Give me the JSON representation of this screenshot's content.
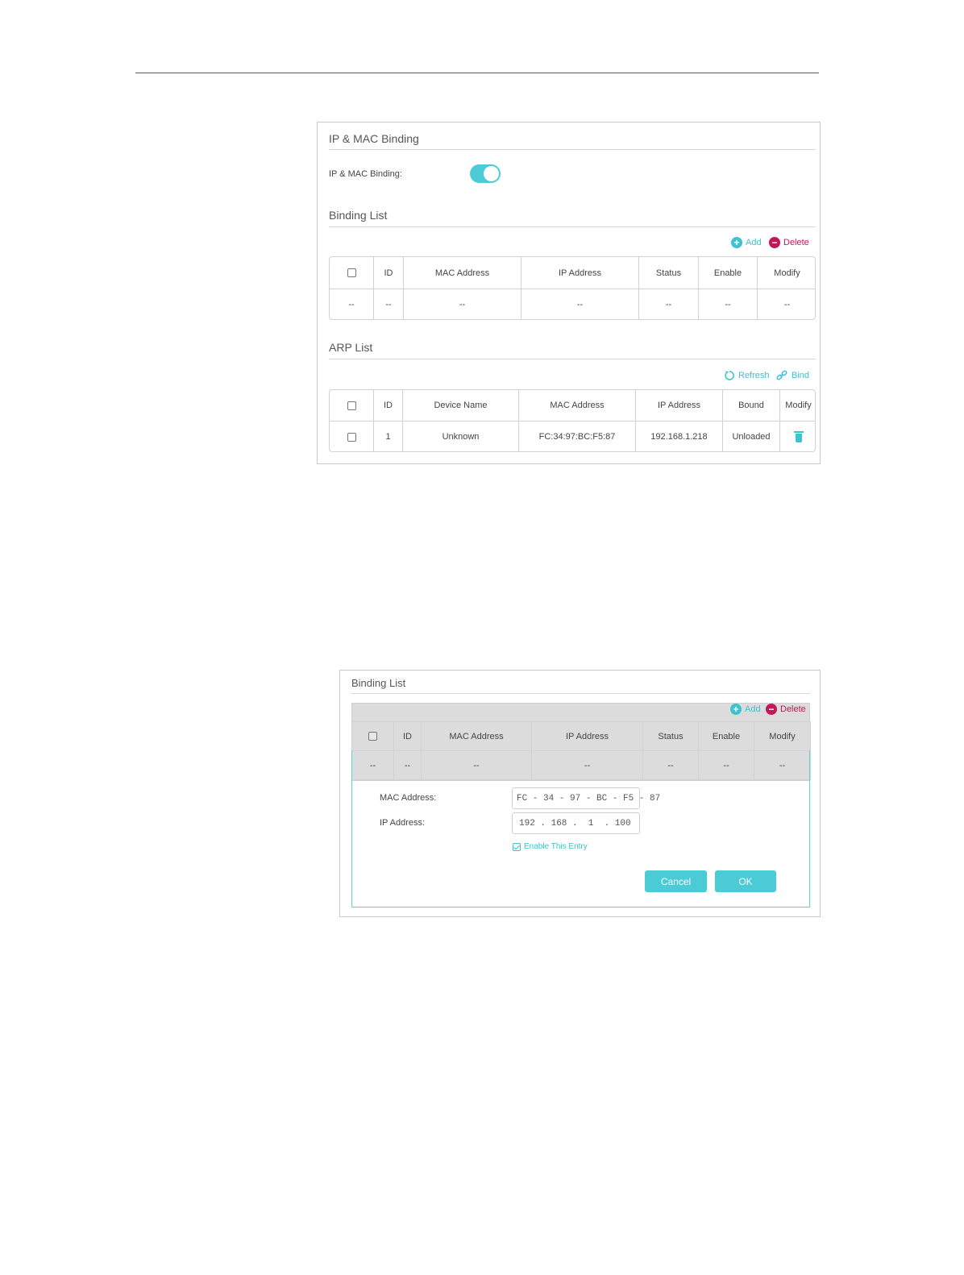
{
  "panel1": {
    "title": "IP & MAC Binding",
    "binding_label": "IP & MAC Binding:",
    "binding_enabled": true,
    "binding_list": {
      "title": "Binding List",
      "add_label": "Add",
      "delete_label": "Delete",
      "headers": [
        "ID",
        "MAC Address",
        "IP Address",
        "Status",
        "Enable",
        "Modify"
      ],
      "row": [
        "--",
        "--",
        "--",
        "--",
        "--",
        "--",
        "--"
      ]
    },
    "arp_list": {
      "title": "ARP List",
      "refresh_label": "Refresh",
      "bind_label": "Bind",
      "headers": [
        "ID",
        "Device Name",
        "MAC Address",
        "IP Address",
        "Bound",
        "Modify"
      ],
      "row": {
        "id": "1",
        "device_name": "Unknown",
        "mac": "FC:34:97:BC:F5:87",
        "ip": "192.168.1.218",
        "bound": "Unloaded"
      }
    }
  },
  "panel2": {
    "title": "Binding List",
    "add_label": "Add",
    "delete_label": "Delete",
    "headers": [
      "ID",
      "MAC Address",
      "IP Address",
      "Status",
      "Enable",
      "Modify"
    ],
    "row": [
      "--",
      "--",
      "--",
      "--",
      "--",
      "--",
      "--"
    ],
    "form": {
      "mac_label": "MAC Address:",
      "mac_value": "FC - 34 - 97 - BC - F5 - 87",
      "ip_label": "IP Address:",
      "ip_value": "192 . 168 .  1  . 100",
      "enable_label": "Enable This Entry",
      "enable_checked": true,
      "cancel_label": "Cancel",
      "ok_label": "OK"
    }
  },
  "colors": {
    "accent": "#4acbd6",
    "delete": "#c2185b"
  }
}
